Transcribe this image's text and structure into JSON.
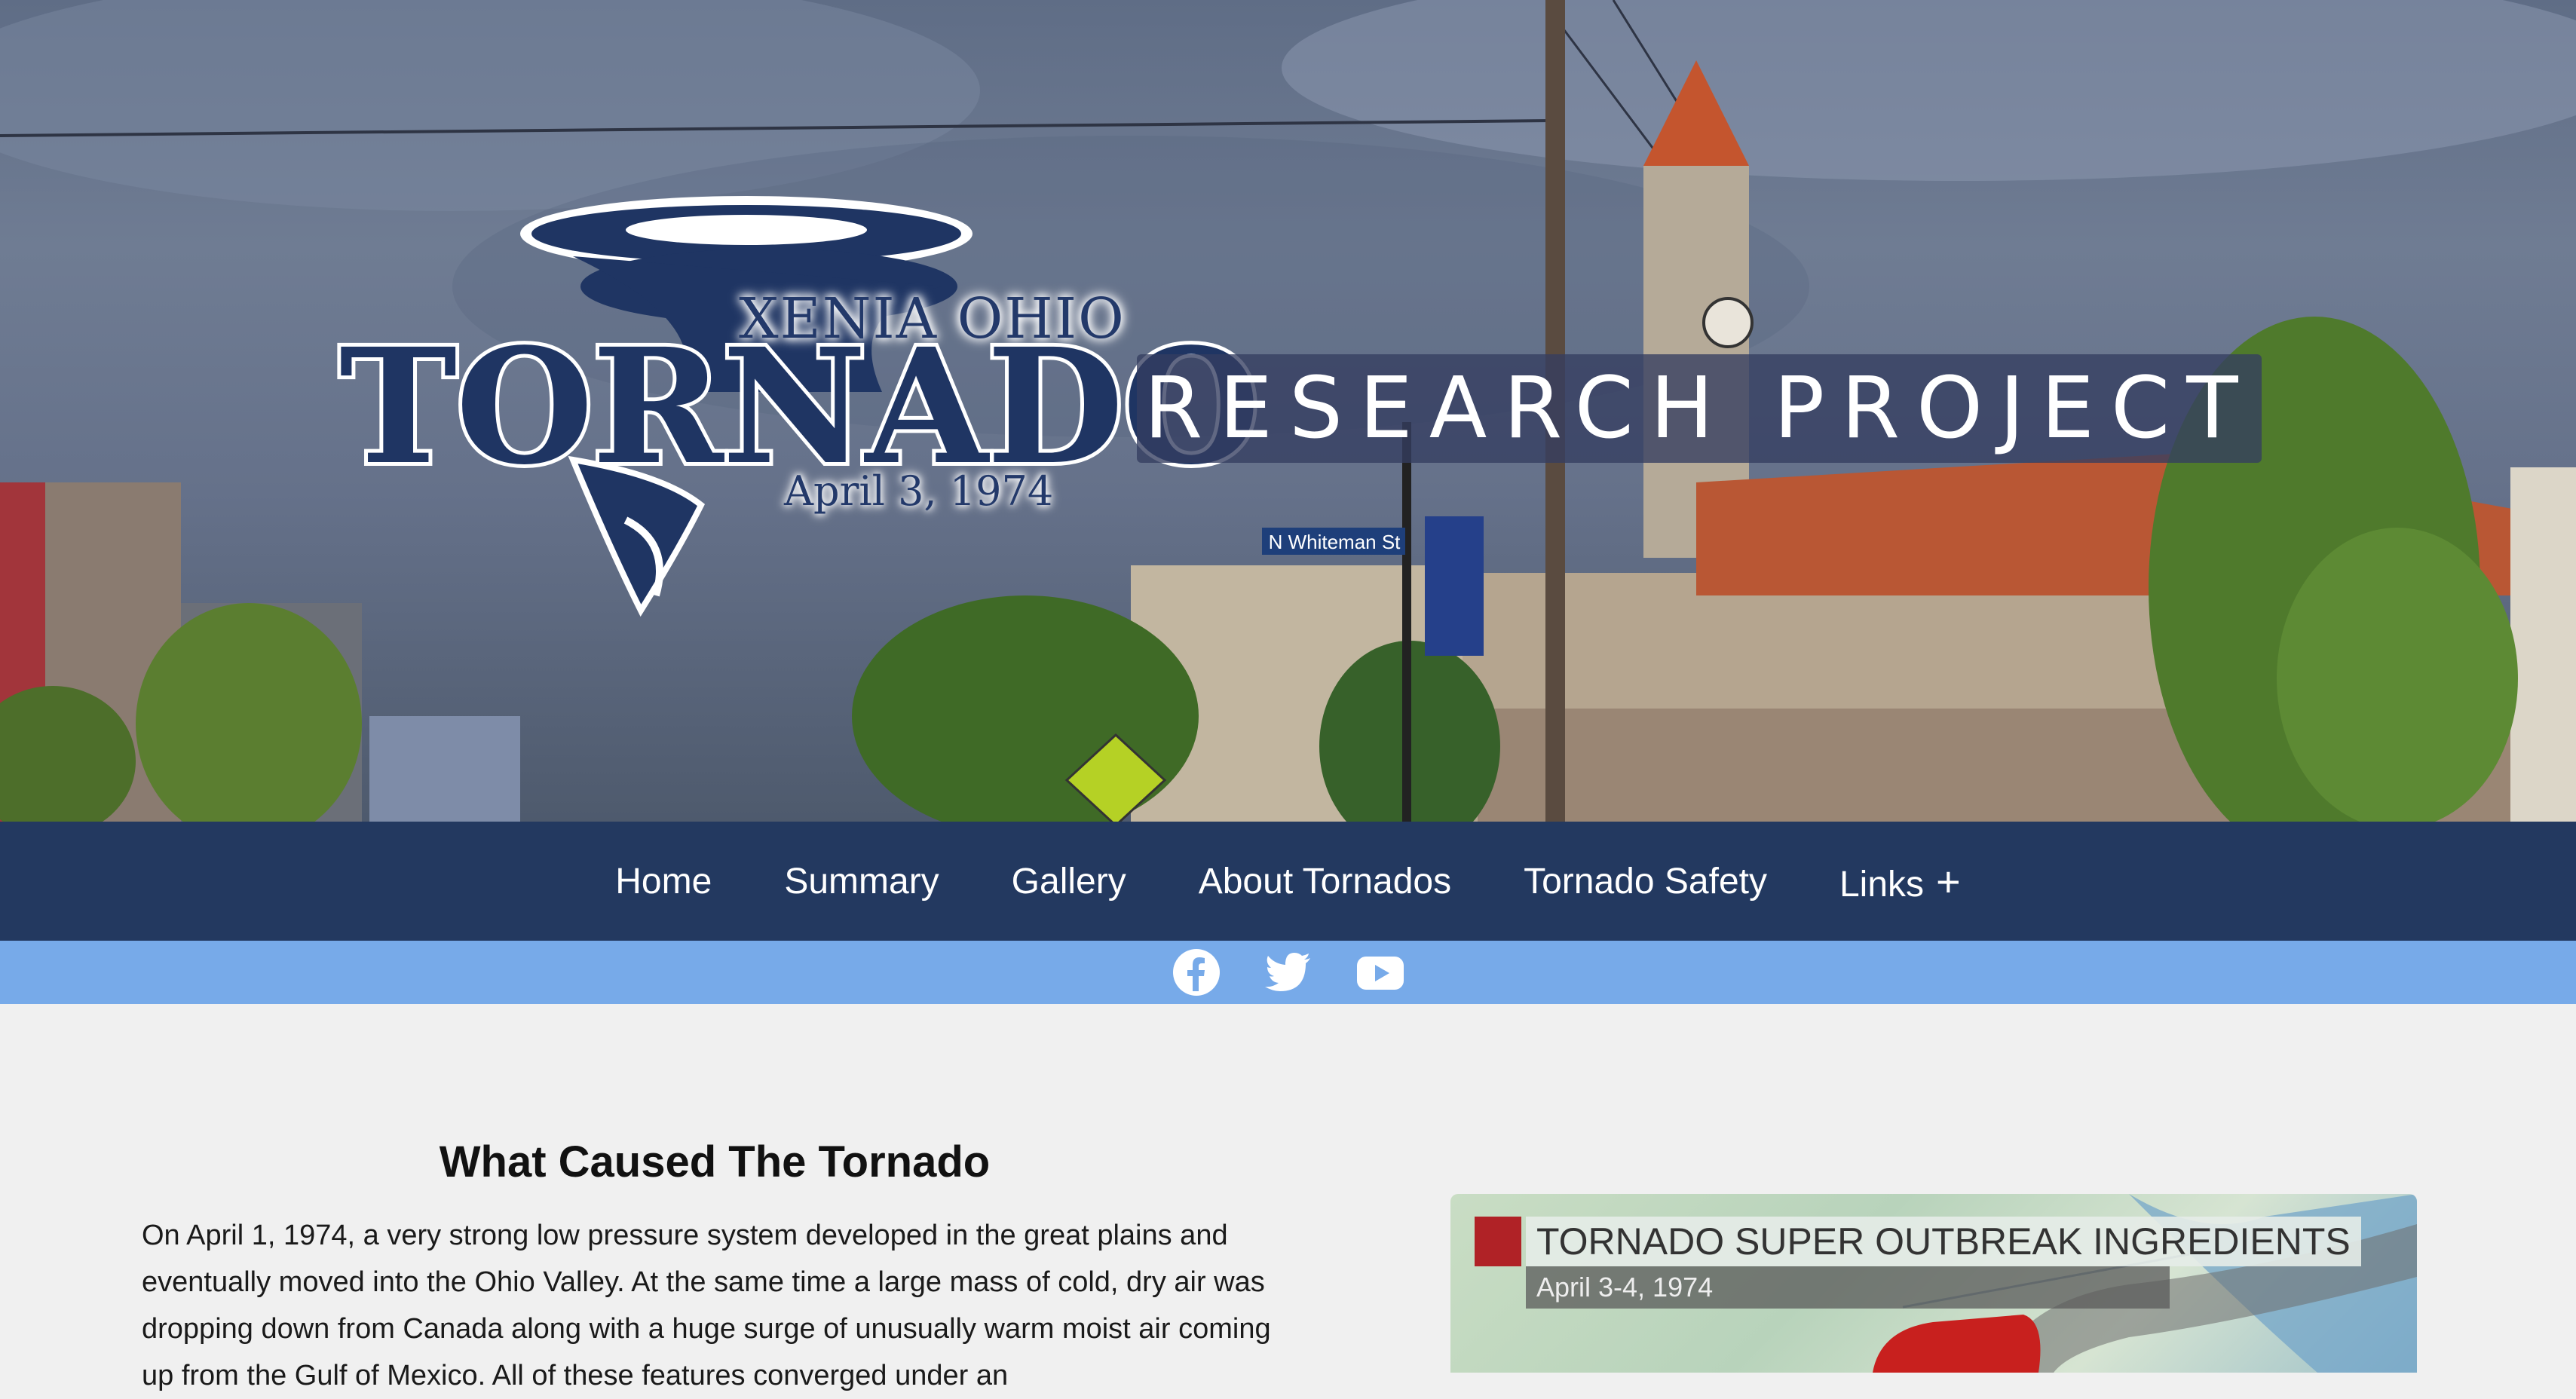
{
  "hero": {
    "logo": {
      "top_line": "XENIA OHIO",
      "main_word": "TORNADO",
      "date_line": "April 3, 1974"
    },
    "banner_text": "RESEARCH PROJECT",
    "street_sign": "N Whiteman St"
  },
  "nav": {
    "items": [
      {
        "label": "Home"
      },
      {
        "label": "Summary"
      },
      {
        "label": "Gallery"
      },
      {
        "label": "About Tornados"
      },
      {
        "label": "Tornado Safety"
      },
      {
        "label": "Links"
      }
    ],
    "links_expand": "+"
  },
  "social": {
    "icons": [
      "facebook-icon",
      "twitter-icon",
      "youtube-icon"
    ],
    "bar_color": "#77aae9"
  },
  "article": {
    "heading": "What Caused The Tornado",
    "paragraph": "On April 1, 1974, a very strong low pressure system developed in the great plains and eventually moved into the Ohio Valley. At the same time a large mass of cold, dry air was dropping down from Canada along with a huge surge of unusually warm moist air coming up from the Gulf of Mexico. All of these features converged under an"
  },
  "map_image": {
    "title": "TORNADO SUPER OUTBREAK INGREDIENTS",
    "subtitle": "April 3-4, 1974"
  },
  "colors": {
    "nav_bg": "#233960",
    "logo_blue": "#1f3563",
    "page_bg": "#f0f0f0"
  }
}
